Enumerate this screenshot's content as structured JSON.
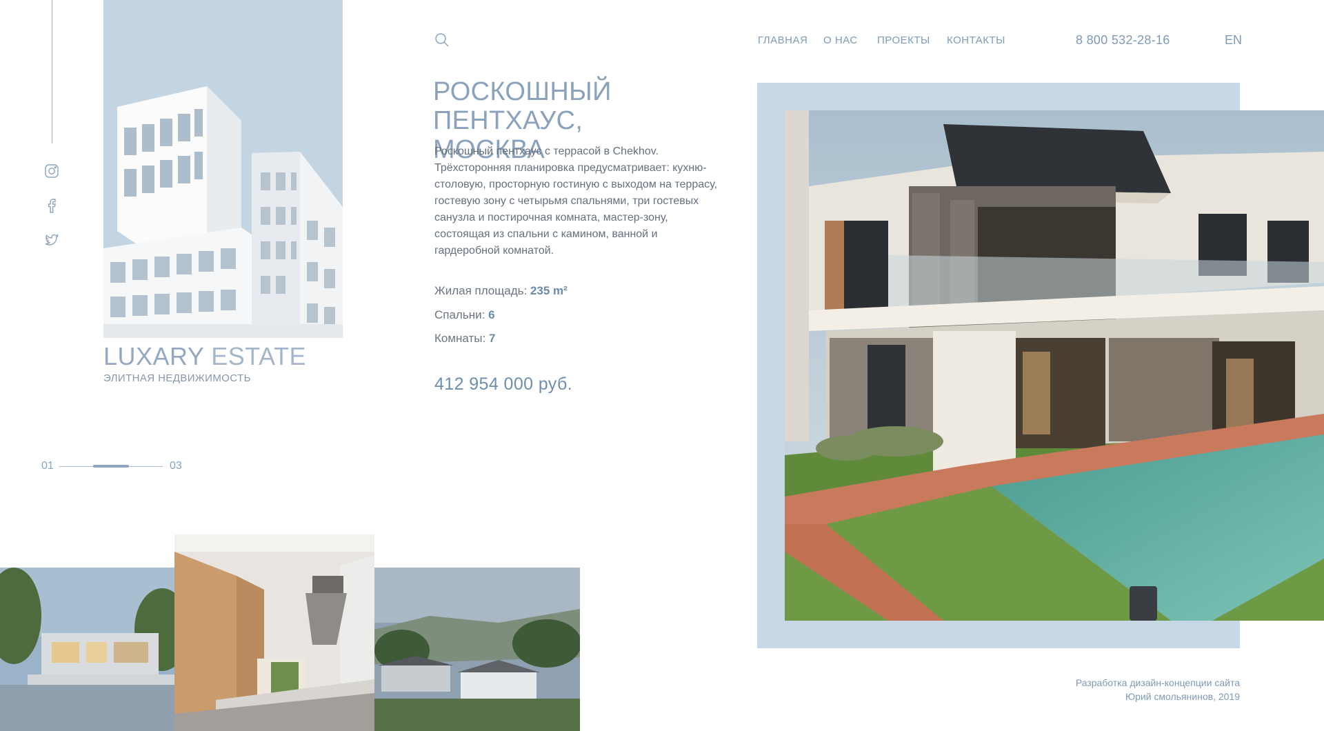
{
  "brand": {
    "word1": "LUXARY",
    "word2": "ESTATE",
    "tagline": "ЭЛИТНАЯ НЕДВИЖИМОСТЬ"
  },
  "nav": {
    "home": "ГЛАВНАЯ",
    "about": "О НАС",
    "projects": "ПРОЕКТЫ",
    "contacts": "КОНТАКТЫ"
  },
  "phone": "8 800 532-28-16",
  "lang": "EN",
  "property": {
    "title_line1": "РОСКОШНЫЙ ПЕНТХАУС,",
    "title_line2": "МОСКВА",
    "description": "Роскошный пентхаус с террасой в Chekhov. Трёхсторонняя планировка предусматривает: кухню-столовую, просторную гостиную с выходом на террасу, гостевую зону с четырьмя спальнями, три гостевых санузла и постирочная комната, мастер-зону, состоящая из спальни с камином, ванной и гардеробной комнатой.",
    "area_label": "Жилая площадь:",
    "area_value": "235 m²",
    "bedrooms_label": "Спальни:",
    "bedrooms_value": "6",
    "rooms_label": "Комнаты:",
    "rooms_value": "7",
    "price": "412 954 000 руб."
  },
  "pager": {
    "current": "01",
    "total": "03",
    "progress": 0.33
  },
  "social": [
    "instagram-icon",
    "facebook-icon",
    "twitter-icon"
  ],
  "credits": {
    "line1": "Разработка дизайн-концепции сайта",
    "line2": "Юрий смольянинов, 2019"
  },
  "colors": {
    "accent": "#7f9ab7",
    "panel": "#c7d7e6",
    "text": "#66707c"
  }
}
